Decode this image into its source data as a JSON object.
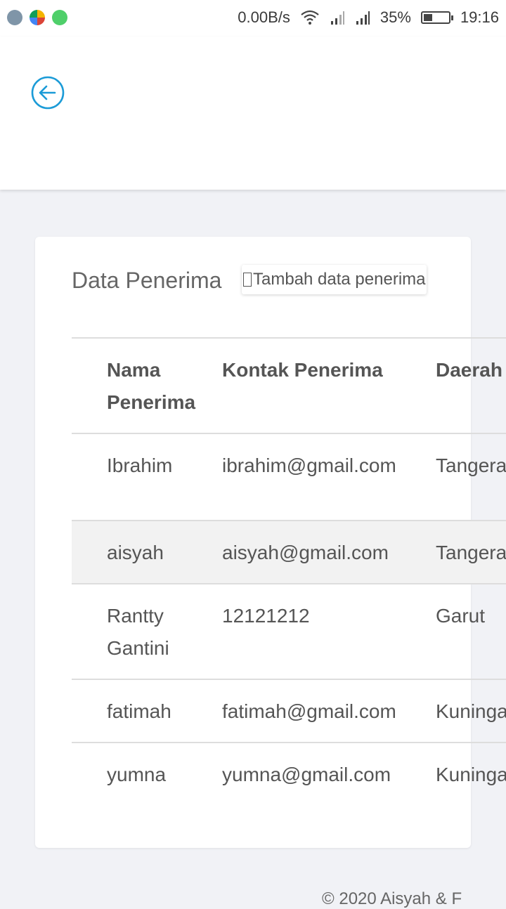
{
  "status_bar": {
    "speed": "0.00B/s",
    "battery": "35%",
    "time": "19:16",
    "battery_level": 0.35
  },
  "header": {
    "back_icon": "arrow-left-circle-icon",
    "accent_color": "#1b9bd7"
  },
  "card": {
    "title": "Data Penerima",
    "add_button": "Tambah data penerima",
    "table": {
      "headers": [
        "Nama Penerima",
        "Kontak Penerima",
        "Daerah"
      ],
      "rows": [
        {
          "nama": "Ibrahim",
          "kontak": "ibrahim@gmail.com",
          "daerah": "Tangerang"
        },
        {
          "nama": "aisyah",
          "kontak": "aisyah@gmail.com",
          "daerah": "Tangerang"
        },
        {
          "nama": "Rantty Gantini",
          "kontak": "12121212",
          "daerah": "Garut"
        },
        {
          "nama": "fatimah",
          "kontak": "fatimah@gmail.com",
          "daerah": "Kuningan"
        },
        {
          "nama": "yumna",
          "kontak": "yumna@gmail.com",
          "daerah": "Kuningan"
        }
      ]
    }
  },
  "footer": {
    "text": "© 2020 Aisyah & F"
  }
}
